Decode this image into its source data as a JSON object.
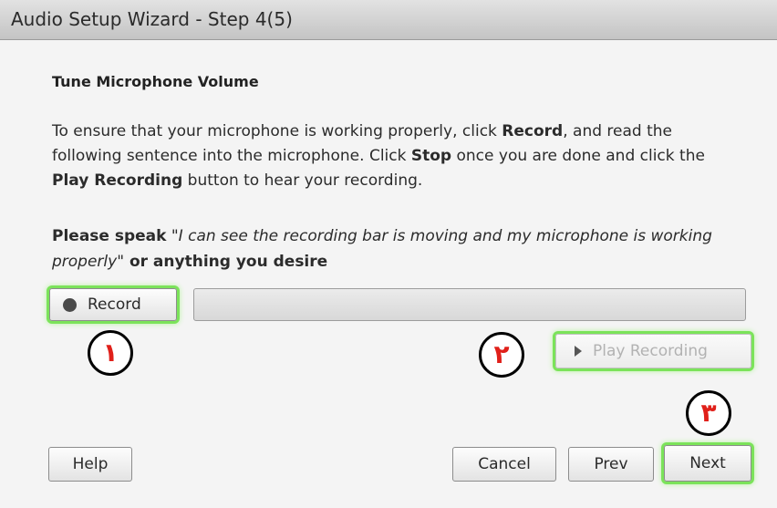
{
  "window": {
    "title": "Audio Setup Wizard - Step 4(5)"
  },
  "content": {
    "heading": "Tune Microphone Volume",
    "para": {
      "p1": "To ensure that your microphone is working properly, click ",
      "b1": "Record",
      "p2": ", and read the following sentence into the microphone. Click ",
      "b2": "Stop",
      "p3": " once you are done and click the ",
      "b3": "Play Recording",
      "p4": " button to hear your recording."
    },
    "speak": {
      "bold1": "Please speak",
      "italic": " \"I can see the recording bar is moving and my microphone is working properly\"",
      "bold2": " or anything you desire"
    }
  },
  "controls": {
    "record_label": "Record",
    "play_label": "Play Recording",
    "recording_level": 0
  },
  "footer": {
    "help_label": "Help",
    "cancel_label": "Cancel",
    "prev_label": "Prev",
    "next_label": "Next"
  },
  "annotations": {
    "marker1": "١",
    "marker2": "٢",
    "marker3": "٣",
    "highlight_color": "#7be35a",
    "marker_color": "#e0201a"
  }
}
